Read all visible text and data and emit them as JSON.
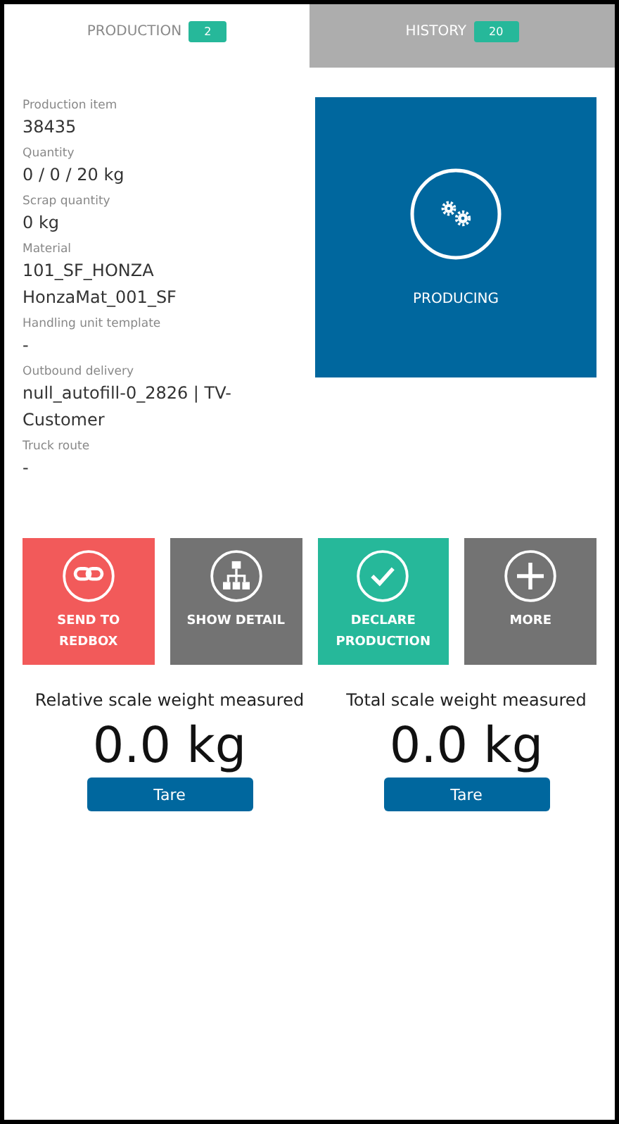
{
  "tabs": [
    {
      "label": "PRODUCTION",
      "count": "2",
      "selected": true
    },
    {
      "label": "HISTORY",
      "count": "20",
      "selected": false
    }
  ],
  "details": [
    {
      "label": "Production item",
      "values": [
        "38435"
      ]
    },
    {
      "label": "Quantity",
      "values": [
        "0 / 0 / 20 kg"
      ]
    },
    {
      "label": "Scrap quantity",
      "values": [
        "0 kg"
      ]
    },
    {
      "label": "Material",
      "values": [
        "101_SF_HONZA",
        "HonzaMat_001_SF"
      ]
    },
    {
      "label": "Handling unit template",
      "values": [
        "-"
      ]
    },
    {
      "label": "Outbound delivery",
      "values": [
        "null_autofill-0_2826 | TV-Customer"
      ]
    },
    {
      "label": "Truck route",
      "values": [
        "-"
      ]
    }
  ],
  "status": {
    "label": "PRODUCING"
  },
  "actions": [
    {
      "label": "SEND TO REDBOX",
      "kind": "link",
      "color": "#f25a5a"
    },
    {
      "label": "SHOW DETAIL",
      "kind": "hierarchy",
      "color": "#737373"
    },
    {
      "label": "DECLARE PRODUCTION",
      "kind": "check",
      "color": "#26b89a"
    },
    {
      "label": "MORE",
      "kind": "plus",
      "color": "#737373"
    }
  ],
  "scales": [
    {
      "title": "Relative scale weight measured",
      "reading": "0.0 kg",
      "button": "Tare"
    },
    {
      "title": "Total scale weight measured",
      "reading": "0.0 kg",
      "button": "Tare"
    }
  ]
}
